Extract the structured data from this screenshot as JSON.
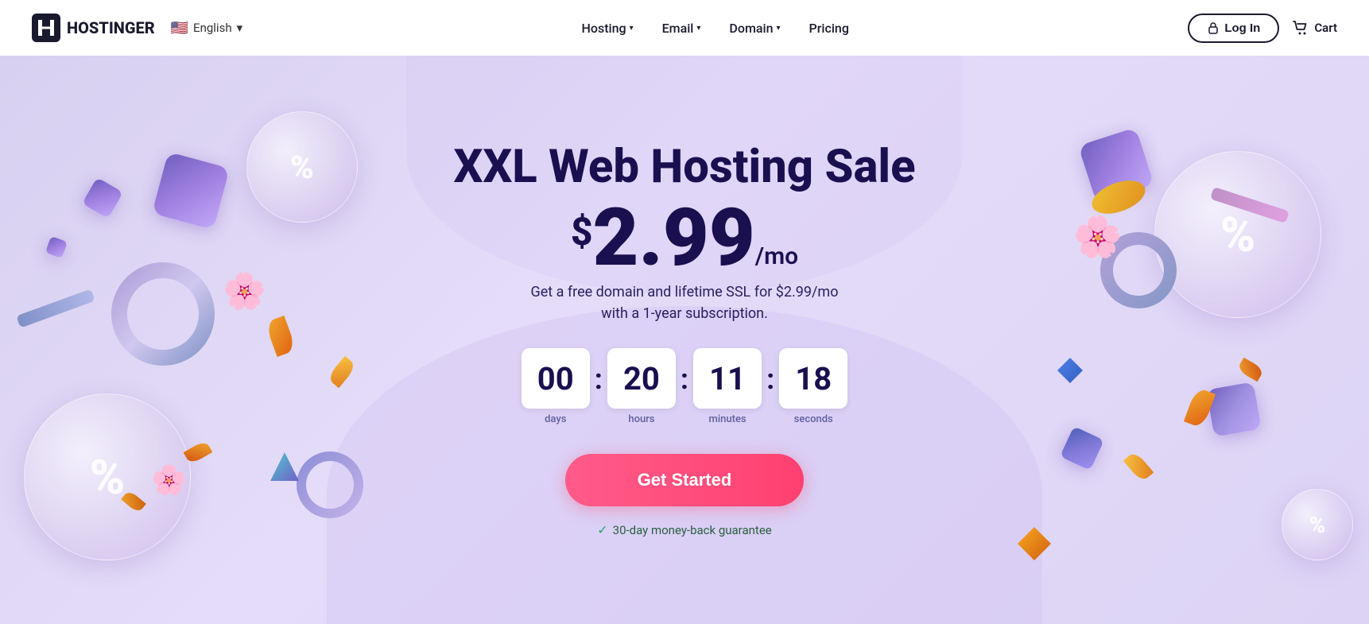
{
  "brand": {
    "name": "HOSTINGER",
    "logo_letter": "H"
  },
  "nav": {
    "lang": {
      "flag": "🇺🇸",
      "label": "English"
    },
    "links": [
      {
        "id": "hosting",
        "label": "Hosting",
        "has_dropdown": true
      },
      {
        "id": "email",
        "label": "Email",
        "has_dropdown": true
      },
      {
        "id": "domain",
        "label": "Domain",
        "has_dropdown": true
      },
      {
        "id": "pricing",
        "label": "Pricing",
        "has_dropdown": false
      }
    ],
    "login_label": "Log In",
    "cart_label": "Cart"
  },
  "hero": {
    "title": "XXL Web Hosting Sale",
    "price_dollar": "$",
    "price_amount": "2.99",
    "price_period": "/mo",
    "subtitle_line1": "Get a free domain and lifetime SSL for $2.99/mo",
    "subtitle_line2": "with a 1-year subscription.",
    "countdown": {
      "days": {
        "value": "00",
        "label": "days"
      },
      "hours": {
        "value": "20",
        "label": "hours"
      },
      "minutes": {
        "value": "11",
        "label": "minutes"
      },
      "seconds": {
        "value": "18",
        "label": "seconds"
      }
    },
    "cta_label": "Get Started",
    "guarantee_check": "✓",
    "guarantee_text": "30-day money-back guarantee"
  }
}
